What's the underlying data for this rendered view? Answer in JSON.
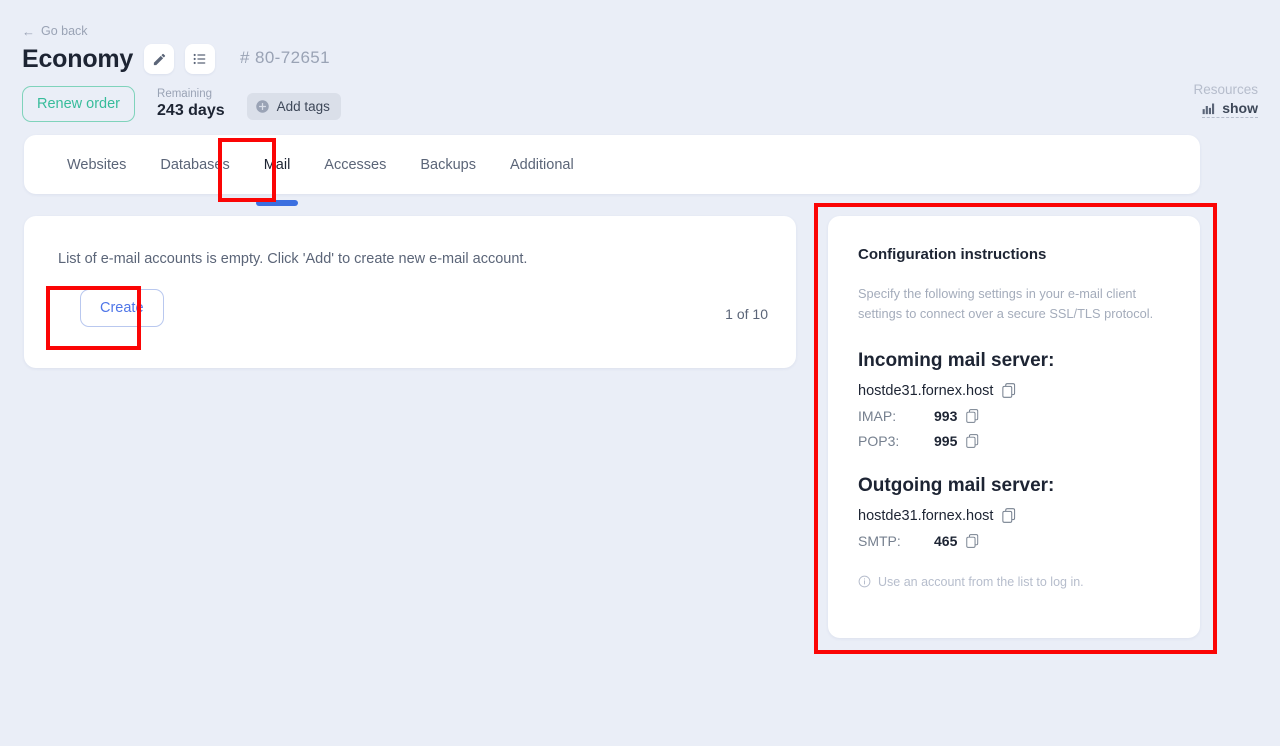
{
  "header": {
    "go_back": "Go back",
    "go_back_icon": "arrow-left-icon",
    "plan_title": "Economy",
    "edit_icon": "pencil-icon",
    "list_icon": "list-icon",
    "order_id": "# 80-72651",
    "renew_label": "Renew order",
    "remaining_label": "Remaining",
    "remaining_value": "243 days",
    "add_tags_label": "Add tags",
    "add_tags_icon": "plus-circle-icon",
    "resources_label": "Resources",
    "resources_show": "show",
    "resources_icon": "chart-icon"
  },
  "tabs": [
    {
      "label": "Websites",
      "active": false
    },
    {
      "label": "Databases",
      "active": false
    },
    {
      "label": "Mail",
      "active": true
    },
    {
      "label": "Accesses",
      "active": false
    },
    {
      "label": "Backups",
      "active": false
    },
    {
      "label": "Additional",
      "active": false
    }
  ],
  "main": {
    "empty_message": "List of e-mail accounts is empty. Click 'Add' to create new e-mail account.",
    "create_label": "Create",
    "pager": "1 of 10"
  },
  "config": {
    "title": "Configuration instructions",
    "description": "Specify the following settings in your e-mail client settings to connect over a secure SSL/TLS protocol.",
    "incoming_heading": "Incoming mail server:",
    "incoming_host": "hostde31.fornex.host",
    "incoming_ports": [
      {
        "name": "IMAP:",
        "value": "993"
      },
      {
        "name": "POP3:",
        "value": "995"
      }
    ],
    "outgoing_heading": "Outgoing mail server:",
    "outgoing_host": "hostde31.fornex.host",
    "outgoing_ports": [
      {
        "name": "SMTP:",
        "value": "465"
      }
    ],
    "note": "Use an account from the list to log in.",
    "note_icon": "info-icon",
    "copy_icon": "copy-icon"
  },
  "highlights": {
    "color": "#fb0505",
    "targets": [
      "tab-mail",
      "create-button",
      "configuration-panel"
    ]
  },
  "colors": {
    "page_background": "#eaeef7",
    "card_background": "#ffffff",
    "accent_blue": "#3b6fe0",
    "link_blue": "#4f76e8",
    "renew_green": "#37bc9b",
    "muted_text": "#9aa3b5",
    "highlight_red": "#fb0505"
  }
}
